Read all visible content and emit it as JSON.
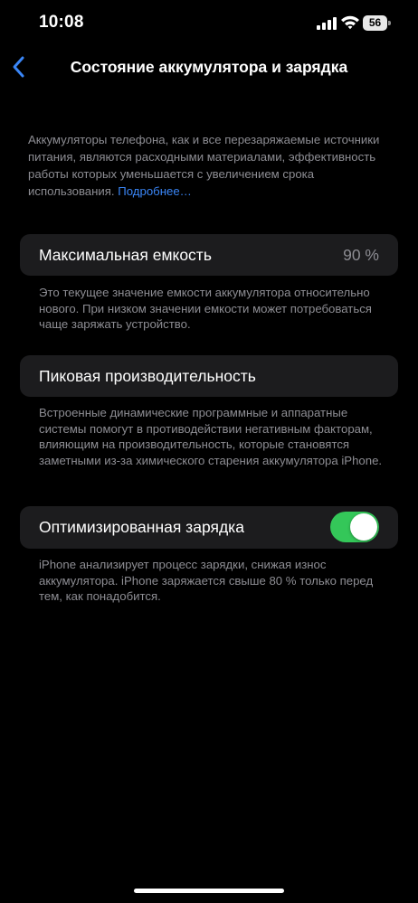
{
  "status_bar": {
    "time": "10:08",
    "battery_level": "56",
    "icons": [
      "cellular-signal-icon",
      "wifi-icon",
      "battery-icon"
    ]
  },
  "nav": {
    "back_icon": "chevron-left-icon",
    "title": "Состояние аккумулятора и зарядка"
  },
  "intro": {
    "text": "Аккумуляторы телефона, как и все перезаряжаемые источники питания, являются расходными материалами, эффективность работы которых уменьшается с увеличением срока использования.",
    "link": "Подробнее…"
  },
  "max_capacity": {
    "label": "Максимальная емкость",
    "value": "90 %",
    "footnote": "Это текущее значение емкости аккумулятора относительно нового. При низком значении емкости может потребоваться чаще заряжать устройство."
  },
  "peak_performance": {
    "label": "Пиковая производительность",
    "footnote": "Встроенные динамические программные и аппаратные системы помогут в противодействии негативным факторам, влияющим на производительность, которые становятся заметными из-за химического старения аккумулятора iPhone."
  },
  "optimized_charging": {
    "label": "Оптимизированная зарядка",
    "enabled": true,
    "footnote": "iPhone анализирует процесс зарядки, снижая износ аккумулятора. iPhone заряжается свыше 80 % только перед тем, как понадобится."
  },
  "colors": {
    "background": "#000000",
    "card": "#1c1c1e",
    "secondary_text": "#8d8d93",
    "link": "#3a86f7",
    "toggle_on": "#34c759"
  }
}
